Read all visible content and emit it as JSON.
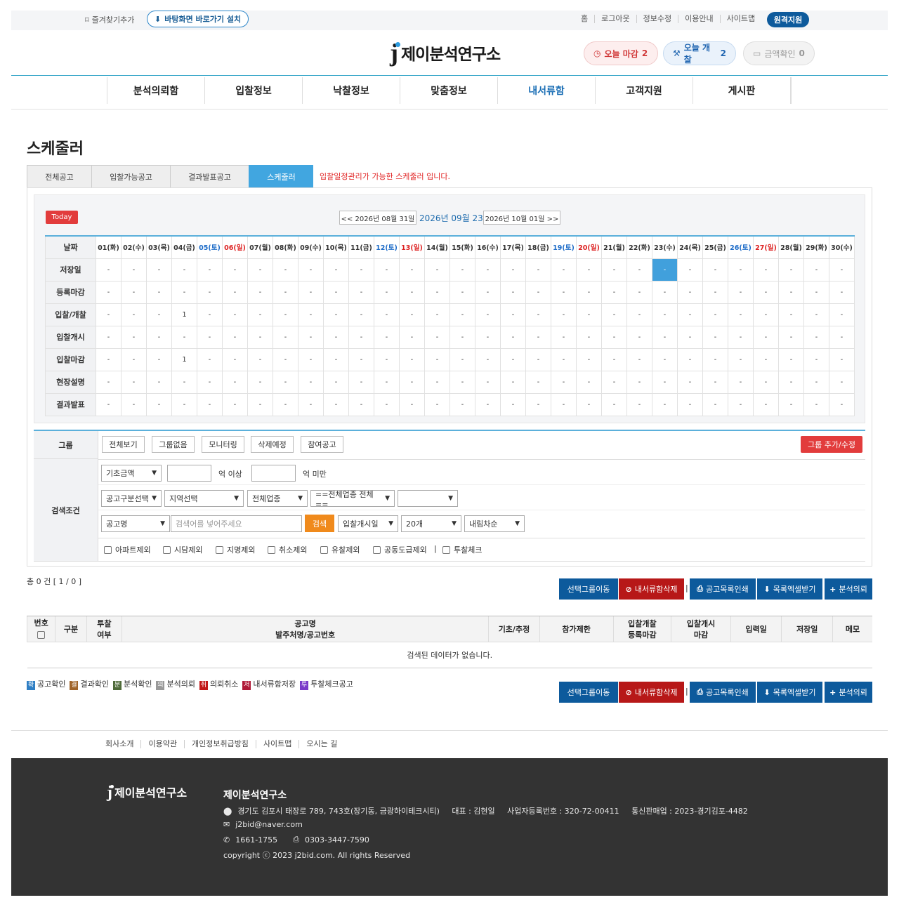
{
  "topbar": {
    "favorite": "즐겨찾기추가",
    "install": "바탕화면 바로가기 설치",
    "links": [
      "홈",
      "로그아웃",
      "정보수정",
      "이용안내",
      "사이트맵"
    ],
    "remote": "원격지원"
  },
  "header": {
    "logo_j": "j",
    "logo_text": "제이분석연구소",
    "deadline_label": "오늘 마감",
    "deadline_count": "2",
    "opening_label": "오늘 개찰",
    "opening_count": "2",
    "amount_label": "금액확인",
    "amount_count": "0"
  },
  "nav": [
    "분석의뢰함",
    "입찰정보",
    "낙찰정보",
    "맞춤정보",
    "내서류함",
    "고객지원",
    "게시판"
  ],
  "page_title": "스케줄러",
  "tabs": [
    "전체공고",
    "입찰가능공고",
    "결과발표공고",
    "스케줄러"
  ],
  "tab_note": "입찰일정관리가 가능한 스케줄러 입니다.",
  "calendar": {
    "today": "Today",
    "prev": "<< 2026년 08월 31일",
    "current": "2026년 09월 23일",
    "next": "2026년 10월 01일 >>",
    "date_header": "날짜",
    "days": [
      "01(화)",
      "02(수)",
      "03(목)",
      "04(금)",
      "05(토)",
      "06(일)",
      "07(월)",
      "08(화)",
      "09(수)",
      "10(목)",
      "11(금)",
      "12(토)",
      "13(일)",
      "14(월)",
      "15(화)",
      "16(수)",
      "17(목)",
      "18(금)",
      "19(토)",
      "20(일)",
      "21(월)",
      "22(화)",
      "23(수)",
      "24(목)",
      "25(금)",
      "26(토)",
      "27(일)",
      "28(월)",
      "29(화)",
      "30(수)"
    ],
    "rows": [
      {
        "label": "저장일",
        "values": [
          "-",
          "-",
          "-",
          "-",
          "-",
          "-",
          "-",
          "-",
          "-",
          "-",
          "-",
          "-",
          "-",
          "-",
          "-",
          "-",
          "-",
          "-",
          "-",
          "-",
          "-",
          "-",
          "-",
          "-",
          "-",
          "-",
          "-",
          "-",
          "-",
          "-"
        ]
      },
      {
        "label": "등록마감",
        "values": [
          "-",
          "-",
          "-",
          "-",
          "-",
          "-",
          "-",
          "-",
          "-",
          "-",
          "-",
          "-",
          "-",
          "-",
          "-",
          "-",
          "-",
          "-",
          "-",
          "-",
          "-",
          "-",
          "-",
          "-",
          "-",
          "-",
          "-",
          "-",
          "-",
          "-"
        ]
      },
      {
        "label": "입찰/개찰",
        "values": [
          "-",
          "-",
          "-",
          "1",
          "-",
          "-",
          "-",
          "-",
          "-",
          "-",
          "-",
          "-",
          "-",
          "-",
          "-",
          "-",
          "-",
          "-",
          "-",
          "-",
          "-",
          "-",
          "-",
          "-",
          "-",
          "-",
          "-",
          "-",
          "-",
          "-"
        ]
      },
      {
        "label": "입찰개시",
        "values": [
          "-",
          "-",
          "-",
          "-",
          "-",
          "-",
          "-",
          "-",
          "-",
          "-",
          "-",
          "-",
          "-",
          "-",
          "-",
          "-",
          "-",
          "-",
          "-",
          "-",
          "-",
          "-",
          "-",
          "-",
          "-",
          "-",
          "-",
          "-",
          "-",
          "-"
        ]
      },
      {
        "label": "입찰마감",
        "values": [
          "-",
          "-",
          "-",
          "1",
          "-",
          "-",
          "-",
          "-",
          "-",
          "-",
          "-",
          "-",
          "-",
          "-",
          "-",
          "-",
          "-",
          "-",
          "-",
          "-",
          "-",
          "-",
          "-",
          "-",
          "-",
          "-",
          "-",
          "-",
          "-",
          "-"
        ]
      },
      {
        "label": "현장설명",
        "values": [
          "-",
          "-",
          "-",
          "-",
          "-",
          "-",
          "-",
          "-",
          "-",
          "-",
          "-",
          "-",
          "-",
          "-",
          "-",
          "-",
          "-",
          "-",
          "-",
          "-",
          "-",
          "-",
          "-",
          "-",
          "-",
          "-",
          "-",
          "-",
          "-",
          "-"
        ]
      },
      {
        "label": "결과발표",
        "values": [
          "-",
          "-",
          "-",
          "-",
          "-",
          "-",
          "-",
          "-",
          "-",
          "-",
          "-",
          "-",
          "-",
          "-",
          "-",
          "-",
          "-",
          "-",
          "-",
          "-",
          "-",
          "-",
          "-",
          "-",
          "-",
          "-",
          "-",
          "-",
          "-",
          "-"
        ]
      }
    ]
  },
  "group": {
    "label": "그룹",
    "buttons": [
      "전체보기",
      "그룹없음",
      "모니터링",
      "삭제예정",
      "참여공고"
    ],
    "add": "그룹 추가/수정"
  },
  "search": {
    "label": "검색조건",
    "amount_select": "기초금액",
    "over": "억 이상",
    "under": "억 미만",
    "type_select": "공고구분선택",
    "region_select": "지역선택",
    "industry_select": "전체업종",
    "industry_all": "==전체업종 전체 ==",
    "name_select": "공고명",
    "keyword_placeholder": "검색어를 넣어주세요",
    "search_btn": "검색",
    "date_select": "입찰개시일",
    "count_select": "20개",
    "order_select": "내림차순",
    "checks": [
      "아파트제외",
      "시담제외",
      "지명제외",
      "취소제외",
      "유찰제외",
      "공동도급제외",
      "투찰체크"
    ]
  },
  "list": {
    "total": "총 0 건 [ 1 / 0 ]",
    "actions": [
      "선택그룹이동",
      "내서류함삭제",
      "공고목록인쇄",
      "목록엑셀받기",
      "분석의뢰"
    ],
    "cols": [
      "번호",
      "구분",
      "투찰",
      "여부",
      "공고명",
      "발주처명/공고번호",
      "기초/추정",
      "참가제한",
      "입찰개찰",
      "등록마감",
      "입찰개시",
      "마감",
      "입력일",
      "저장일",
      "메모"
    ],
    "empty": "검색된 데이터가 없습니다."
  },
  "legend": [
    {
      "k": "확",
      "label": "공고확인",
      "color": "#2f7fc4"
    },
    {
      "k": "결",
      "label": "결과확인",
      "color": "#a0642a"
    },
    {
      "k": "분",
      "label": "분석확인",
      "color": "#4f6b3a"
    },
    {
      "k": "의",
      "label": "분석의뢰",
      "color": "#999999"
    },
    {
      "k": "취",
      "label": "의뢰취소",
      "color": "#c21818"
    },
    {
      "k": "저",
      "label": "내서류함저장",
      "color": "#b01a38"
    },
    {
      "k": "투",
      "label": "투찰체크공고",
      "color": "#7a3bc9"
    }
  ],
  "footer": {
    "links": [
      "회사소개",
      "이용약관",
      "개인정보취급방침",
      "사이트맵",
      "오시는 길"
    ],
    "name": "제이분석연구소",
    "address": "경기도 김포시 태장로 789, 743호(장기동, 금광하이테크시티)     대표 : 김현일     사업자등록번호 : 320-72-00411     통신판매업 : 2023-경기김포-4482",
    "email": "j2bid@naver.com",
    "phone": "1661-1755",
    "fax": "0303-3447-7590",
    "copyright": "copyright ⓒ 2023 j2bid.com. All rights Reserved"
  }
}
